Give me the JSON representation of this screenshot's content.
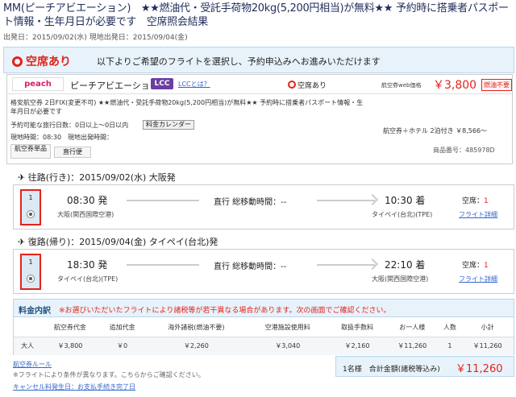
{
  "header": {
    "title": "MM(ピーチアビエーション)　★★燃油代・受託手荷物20kg(5,200円相当)が無料★★ 予約時に搭乗者パスポート情報・生年月日が必要です　空席照会結果",
    "dates": "出発日：2015/09/02(水) 現地出発日：2015/09/04(金)"
  },
  "availability": {
    "status": "空席あり",
    "message": "以下よりご希望のフライトを選択し、予約申込みへお進みいただけます"
  },
  "card": {
    "logo": "peach",
    "airline": "ピーチアビエーション",
    "lcc_badge": "LCC",
    "lcc_link": "LCCとは？",
    "seat_status": "空席あり",
    "price_label": "航空券web価格",
    "price": "￥3,800",
    "nonrefund": "燃油不要",
    "description": "格安航空券 2日FIX(変更不可) ★★燃油代・受託手荷物20kg(5,200円相当)が無料★★ 予約時に搭乗者パスポート情報・生年月日が必要です",
    "period": "予約可能な旅行日数：0日以上〜0日以内",
    "calendar_btn": "料金カレンダー",
    "times": "現地時間：08:30　現地出発時間：",
    "tag1": "航空券単品",
    "tag2": "直行便",
    "hotel_link": "航空券＋ホテル 2泊付き ￥8,566〜",
    "product_no": "商品番号：485978D"
  },
  "outbound": {
    "title": "往路(行き)：2015/09/02(水) 大阪発",
    "number": "1",
    "dep_time": "08:30 発",
    "dep_airport": "大阪(関西国際空港)",
    "route_type": "直行 総移動時間：--",
    "arr_time": "10:30 着",
    "arr_airport": "タイペイ(台北)(TPE)",
    "seats_label": "空席：",
    "seats_value": "1",
    "detail": "フライト詳細"
  },
  "inbound": {
    "title": "復路(帰り)：2015/09/04(金) タイペイ(台北)発",
    "number": "1",
    "dep_time": "18:30 発",
    "dep_airport": "タイペイ(台北)(TPE)",
    "route_type": "直行 総移動時間：--",
    "arr_time": "22:10 着",
    "arr_airport": "大阪(関西国際空港)",
    "seats_label": "空席：",
    "seats_value": "1",
    "detail": "フライト詳細"
  },
  "fare": {
    "title": "料金内訳",
    "note": "※お選びいただいたフライトにより諸税等が若干異なる場合があります。次の画面でご確認ください。",
    "headers": [
      "",
      "航空券代金",
      "追加代金",
      "海外諸税(燃油不要)",
      "空港施設使用料",
      "取扱手数料",
      "お一人様",
      "人数",
      "小計"
    ],
    "row": [
      "大人",
      "￥3,800",
      "￥0",
      "￥2,260",
      "￥3,040",
      "￥2,160",
      "￥11,260",
      "1",
      "￥11,260"
    ]
  },
  "footer": {
    "rule_link": "航空券ルール",
    "rule_note": "※フライトにより条件が異なります。こちらからご確認ください。",
    "cancel_link": "キャンセル料発生日：お支払手続き完了日",
    "total_label": "1名様　合計金額(諸税等込み)",
    "total_price": "￥11,260"
  },
  "colors": {
    "accent": "#e2231a",
    "header_bg": "#e7f2fa",
    "link": "#3366cc",
    "lcc": "#6a3fa1"
  }
}
